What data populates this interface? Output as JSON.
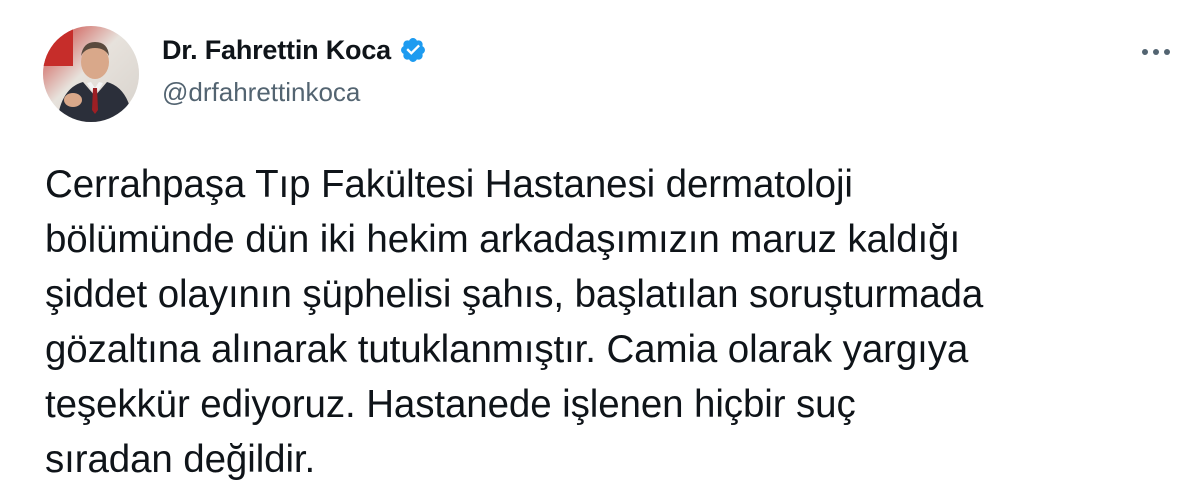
{
  "author": {
    "display_name": "Dr. Fahrettin Koca",
    "handle": "@drfahrettinkoca",
    "verified": true,
    "verified_icon": "verified-badge-icon",
    "verified_color": "#1d9bf0"
  },
  "menu": {
    "icon": "more-options-icon"
  },
  "tweet": {
    "text": "Cerrahpaşa Tıp Fakültesi Hastanesi dermatoloji\nbölümünde dün iki hekim arkadaşımızın maruz kaldığı\nşiddet olayının şüphelisi şahıs, başlatılan soruşturmada\ngözaltına alınarak tutuklanmıştır. Camia olarak yargıya\nteşekkür ediyoruz. Hastanede işlenen hiçbir suç\nsıradan değildir."
  },
  "colors": {
    "text_primary": "#0f1419",
    "text_secondary": "#536471",
    "background": "#ffffff",
    "accent": "#1d9bf0"
  }
}
